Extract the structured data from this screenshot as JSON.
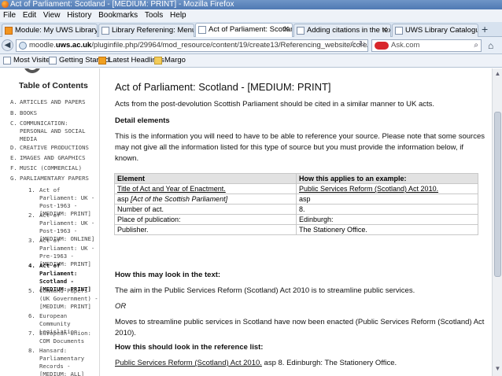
{
  "window": {
    "title": "Act of Parliament: Scotland - [MEDIUM: PRINT] - Mozilla Firefox"
  },
  "menu": [
    "File",
    "Edit",
    "View",
    "History",
    "Bookmarks",
    "Tools",
    "Help"
  ],
  "tabs": [
    {
      "label": "Module: My UWS Library"
    },
    {
      "label": "Library Referening: Menu"
    },
    {
      "label": "Act of Parliament: Scotland ..."
    },
    {
      "label": "Adding citations in the text:..."
    },
    {
      "label": "UWS Library Catalogue"
    }
  ],
  "nav": {
    "url_prefix": "moodle.",
    "url_domain": "uws.ac.uk",
    "url_rest": "/pluginfile.php/29964/mod_resource/content/19/create13/Referencing_website/core/core/page_56.h",
    "search_placeholder": "Ask.com"
  },
  "bookmarks": [
    "Most Visited",
    "Getting Started",
    "Latest Headlines",
    "Margo"
  ],
  "toc": {
    "title": "Table of Contents",
    "sections": [
      {
        "letter": "A.",
        "text": "ARTICLES AND PAPERS"
      },
      {
        "letter": "B.",
        "text": "BOOKS"
      },
      {
        "letter": "C.",
        "text": "COMMUNICATION: PERSONAL AND SOCIAL MEDIA"
      },
      {
        "letter": "D.",
        "text": "CREATIVE PRODUCTIONS"
      },
      {
        "letter": "E.",
        "text": "IMAGES AND GRAPHICS"
      },
      {
        "letter": "F.",
        "text": "MUSIC (COMMERCIAL)"
      },
      {
        "letter": "G.",
        "text": "PARLIAMENTARY PAPERS"
      }
    ],
    "subitems": [
      {
        "num": "1.",
        "text": "Act of Parliament: UK - Post-1963 - [MEDIUM: PRINT]"
      },
      {
        "num": "2.",
        "text": "Act of Parliament: UK - Post-1963 - [MEDIUM: ONLINE]"
      },
      {
        "num": "3.",
        "text": "Act of Parliament: UK - Pre-1963 - [MEDIUM: PRINT]"
      },
      {
        "num": "4.",
        "text": "Act of Parliament: Scotland - [MEDIUM: PRINT]"
      },
      {
        "num": "5.",
        "text": "Command Papers (UK Government) - [MEDIUM: PRINT]"
      },
      {
        "num": "6.",
        "text": "European Community Legislation"
      },
      {
        "num": "7.",
        "text": "European Union: COM Documents"
      },
      {
        "num": "8.",
        "text": "Hansard: Parliamentary Records - [MEDIUM: ALL]"
      }
    ]
  },
  "content": {
    "title": "Act of Parliament: Scotland - [MEDIUM: PRINT]",
    "intro": "Acts from the post-devolution Scottish Parliament should be cited in a similar manner to UK acts.",
    "detail_heading": "Detail elements",
    "detail_text": "This is the information you will need to have to be able to reference your source. Please note that some sources may not give all the information listed for this type of source but you must provide the information below, if known.",
    "table": {
      "headers": [
        "Element",
        "How this applies to an example:"
      ],
      "rows": [
        [
          "Title of Act and Year of Enactment.",
          "Public Services Reform (Scotland) Act 2010."
        ],
        [
          "asp ",
          "asp"
        ],
        [
          "Number of act.",
          "8."
        ],
        [
          "Place of publication:",
          "Edinburgh:"
        ],
        [
          "Publisher.",
          "The Stationery Office."
        ]
      ],
      "row1_italic": "[Act of the Scottish Parliament]"
    },
    "look_heading": "How this may look in the text:",
    "look_example1": "The aim in the Public Services Reform (Scotland) Act 2010 is to streamline public services.",
    "or": "OR",
    "look_example2": "Moves to streamline public services in Scotland have now been enacted (Public Services Reform (Scotland) Act 2010).",
    "ref_heading": "How this should look in the reference list:",
    "ref_title": "Public Services Reform (Scotland) Act 2010.",
    "ref_rest": " asp 8. Edinburgh: The Stationery Office."
  }
}
